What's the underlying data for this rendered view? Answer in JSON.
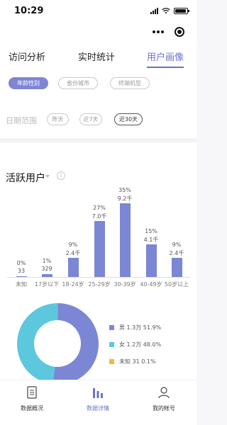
{
  "status": {
    "time": "10:29"
  },
  "tabs": [
    {
      "label": "访问分析"
    },
    {
      "label": "实时统计"
    },
    {
      "label": "用户画像"
    }
  ],
  "filters": {
    "dimension": [
      "年龄性别",
      "省份城市",
      "终端机型"
    ],
    "date_label": "日期范围",
    "date_options": [
      "昨天",
      "近7天",
      "近30天"
    ]
  },
  "section": {
    "title": "活跃用户"
  },
  "chart_data": [
    {
      "type": "bar",
      "categories": [
        "未知",
        "17岁以下",
        "18-24岁",
        "25-29岁",
        "30-39岁",
        "40-49岁",
        "50岁以上"
      ],
      "percents": [
        "0%",
        "1%",
        "9%",
        "27%",
        "35%",
        "15%",
        "9%"
      ],
      "value_labels": [
        "33",
        "329",
        "2.4千",
        "7.0千",
        "9.2千",
        "4.1千",
        "2.4千"
      ],
      "values": [
        33,
        329,
        2400,
        7000,
        9200,
        4100,
        2400
      ],
      "color": "#7b86d5"
    },
    {
      "type": "pie",
      "labels": [
        "男 1.3万 51.9%",
        "女 1.2万 48.0%",
        "未知 31 0.1%"
      ],
      "values": [
        51.9,
        48.0,
        0.1
      ],
      "colors": [
        "#7b86d5",
        "#5cc7dd",
        "#f2b63f"
      ]
    }
  ],
  "bottom_nav": [
    {
      "label": "数据概况"
    },
    {
      "label": "数据详情"
    },
    {
      "label": "我的帐号"
    }
  ],
  "colors": {
    "accent": "#6a73c9"
  }
}
